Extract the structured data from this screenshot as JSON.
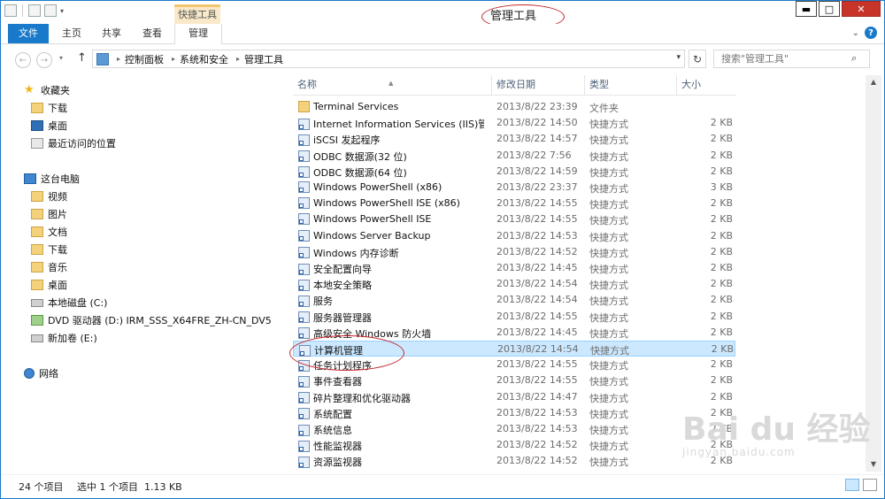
{
  "window": {
    "title": "管理工具",
    "context_tab": "快捷工具",
    "controls": {
      "minimize": "▬",
      "maximize": "□",
      "close": "✕"
    }
  },
  "ribbon": {
    "tabs": [
      "文件",
      "主页",
      "共享",
      "查看",
      "管理"
    ],
    "chevron": "⌄",
    "help": "?"
  },
  "nav": {
    "back": "←",
    "forward": "→",
    "recent": "▾",
    "up": "↑",
    "breadcrumb": [
      "控制面板",
      "系统和安全",
      "管理工具"
    ],
    "refresh": "↻",
    "search_placeholder": "搜索\"管理工具\"",
    "search_icon": "⌕"
  },
  "sidebar": {
    "favorites": {
      "label": "收藏夹",
      "items": [
        "下载",
        "桌面",
        "最近访问的位置"
      ]
    },
    "computer": {
      "label": "这台电脑",
      "items": [
        "视频",
        "图片",
        "文档",
        "下载",
        "音乐",
        "桌面",
        "本地磁盘 (C:)",
        "DVD 驱动器 (D:) IRM_SSS_X64FRE_ZH-CN_DV5",
        "新加卷 (E:)"
      ]
    },
    "network": {
      "label": "网络"
    }
  },
  "columns": {
    "name": "名称",
    "date": "修改日期",
    "type": "类型",
    "size": "大小"
  },
  "files": [
    {
      "name": "Terminal Services",
      "date": "2013/8/22 23:39",
      "type": "文件夹",
      "size": "",
      "icon": "folder"
    },
    {
      "name": "Internet Information Services (IIS)管...",
      "date": "2013/8/22 14:50",
      "type": "快捷方式",
      "size": "2 KB",
      "icon": "shortcut"
    },
    {
      "name": "iSCSI 发起程序",
      "date": "2013/8/22 14:57",
      "type": "快捷方式",
      "size": "2 KB",
      "icon": "shortcut"
    },
    {
      "name": "ODBC 数据源(32 位)",
      "date": "2013/8/22 7:56",
      "type": "快捷方式",
      "size": "2 KB",
      "icon": "shortcut"
    },
    {
      "name": "ODBC 数据源(64 位)",
      "date": "2013/8/22 14:59",
      "type": "快捷方式",
      "size": "2 KB",
      "icon": "shortcut"
    },
    {
      "name": "Windows PowerShell (x86)",
      "date": "2013/8/22 23:37",
      "type": "快捷方式",
      "size": "3 KB",
      "icon": "shortcut"
    },
    {
      "name": "Windows PowerShell ISE (x86)",
      "date": "2013/8/22 14:55",
      "type": "快捷方式",
      "size": "2 KB",
      "icon": "shortcut"
    },
    {
      "name": "Windows PowerShell ISE",
      "date": "2013/8/22 14:55",
      "type": "快捷方式",
      "size": "2 KB",
      "icon": "shortcut"
    },
    {
      "name": "Windows Server Backup",
      "date": "2013/8/22 14:53",
      "type": "快捷方式",
      "size": "2 KB",
      "icon": "shortcut"
    },
    {
      "name": "Windows 内存诊断",
      "date": "2013/8/22 14:52",
      "type": "快捷方式",
      "size": "2 KB",
      "icon": "shortcut"
    },
    {
      "name": "安全配置向导",
      "date": "2013/8/22 14:45",
      "type": "快捷方式",
      "size": "2 KB",
      "icon": "shortcut"
    },
    {
      "name": "本地安全策略",
      "date": "2013/8/22 14:54",
      "type": "快捷方式",
      "size": "2 KB",
      "icon": "shortcut"
    },
    {
      "name": "服务",
      "date": "2013/8/22 14:54",
      "type": "快捷方式",
      "size": "2 KB",
      "icon": "shortcut"
    },
    {
      "name": "服务器管理器",
      "date": "2013/8/22 14:55",
      "type": "快捷方式",
      "size": "2 KB",
      "icon": "shortcut"
    },
    {
      "name": "高级安全 Windows 防火墙",
      "date": "2013/8/22 14:45",
      "type": "快捷方式",
      "size": "2 KB",
      "icon": "shortcut"
    },
    {
      "name": "计算机管理",
      "date": "2013/8/22 14:54",
      "type": "快捷方式",
      "size": "2 KB",
      "icon": "shortcut",
      "selected": true
    },
    {
      "name": "任务计划程序",
      "date": "2013/8/22 14:55",
      "type": "快捷方式",
      "size": "2 KB",
      "icon": "shortcut"
    },
    {
      "name": "事件查看器",
      "date": "2013/8/22 14:55",
      "type": "快捷方式",
      "size": "2 KB",
      "icon": "shortcut"
    },
    {
      "name": "碎片整理和优化驱动器",
      "date": "2013/8/22 14:47",
      "type": "快捷方式",
      "size": "2 KB",
      "icon": "shortcut"
    },
    {
      "name": "系统配置",
      "date": "2013/8/22 14:53",
      "type": "快捷方式",
      "size": "2 KB",
      "icon": "shortcut"
    },
    {
      "name": "系统信息",
      "date": "2013/8/22 14:53",
      "type": "快捷方式",
      "size": "2 KB",
      "icon": "shortcut"
    },
    {
      "name": "性能监视器",
      "date": "2013/8/22 14:52",
      "type": "快捷方式",
      "size": "2 KB",
      "icon": "shortcut"
    },
    {
      "name": "资源监视器",
      "date": "2013/8/22 14:52",
      "type": "快捷方式",
      "size": "2 KB",
      "icon": "shortcut"
    }
  ],
  "status": {
    "count": "24 个项目",
    "selection": "选中 1 个项目  1.13 KB"
  },
  "watermark": {
    "brand": "Bai du 经验",
    "url": "jingyan.baidu.com"
  },
  "colors": {
    "accent": "#1979ca",
    "selection": "#cce8ff",
    "annotation": "#c3262c",
    "context_tab": "#f9e9c9"
  }
}
